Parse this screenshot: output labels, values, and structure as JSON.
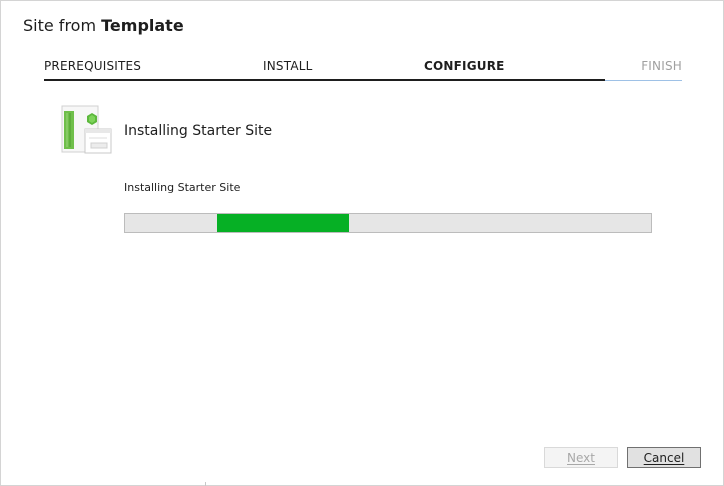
{
  "dialog": {
    "title_prefix": "Site from ",
    "title_strong": "Template"
  },
  "wizard": {
    "steps": [
      {
        "label": "PREREQUISITES",
        "state": "done"
      },
      {
        "label": "INSTALL",
        "state": "done"
      },
      {
        "label": "CONFIGURE",
        "state": "current"
      },
      {
        "label": "FINISH",
        "state": "pending"
      }
    ]
  },
  "main": {
    "icon": "package-icon",
    "heading": "Installing Starter Site",
    "status_text": "Installing Starter Site",
    "progress": {
      "style": "indeterminate marquee",
      "color": "#06b025"
    }
  },
  "buttons": {
    "next_label": "Next",
    "cancel_label": "Cancel",
    "next_enabled": false
  },
  "colors": {
    "accent_line": "#1e1e1e",
    "pending_line": "#9ec1e6",
    "progress_fill": "#06b025"
  }
}
